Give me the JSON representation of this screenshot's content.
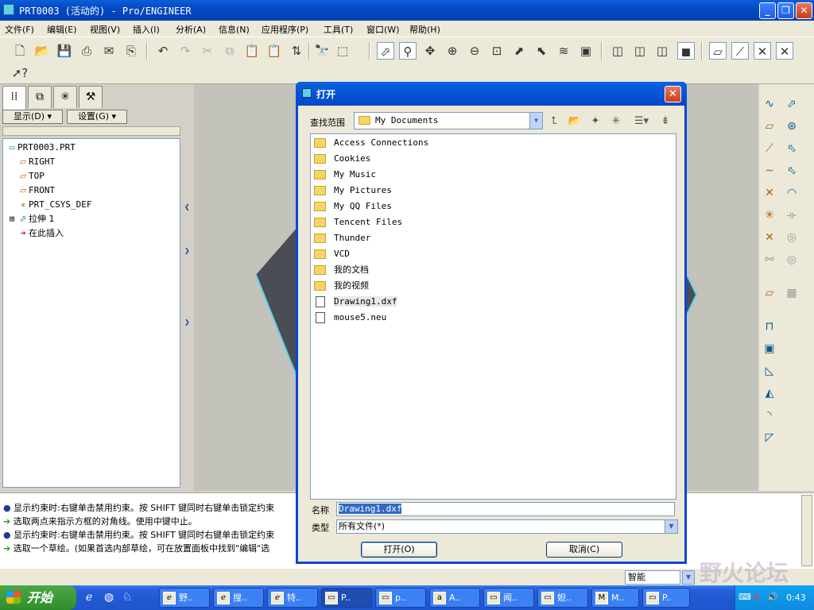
{
  "window": {
    "title": "PRT0003 (活动的) - Pro/ENGINEER"
  },
  "menu": [
    "文件(F)",
    "编辑(E)",
    "视图(V)",
    "插入(I)",
    "分析(A)",
    "信息(N)",
    "应用程序(P)",
    "工具(T)",
    "窗口(W)",
    "帮助(H)"
  ],
  "panel": {
    "show_button": "显示(D) ▾",
    "settings_button": "设置(G) ▾",
    "tree": [
      {
        "label": "PRT0003.PRT",
        "icon": "part-icon"
      },
      {
        "label": "RIGHT",
        "icon": "datum-plane-icon"
      },
      {
        "label": "TOP",
        "icon": "datum-plane-icon"
      },
      {
        "label": "FRONT",
        "icon": "datum-plane-icon"
      },
      {
        "label": "PRT_CSYS_DEF",
        "icon": "csys-icon"
      },
      {
        "label": "拉伸 1",
        "icon": "extrude-icon"
      },
      {
        "label": "在此插入",
        "icon": "insert-arrow-icon"
      }
    ]
  },
  "messages": [
    "显示约束时:右键单击禁用约束。按 SHIFT 键同时右键单击锁定约束",
    "选取两点来指示方框的对角线。使用中键中止。",
    "显示约束时:右键单击禁用约束。按 SHIFT 键同时右键单击锁定约束",
    "选取一个草绘。(如果首选内部草绘，可在放置面板中找到\"编辑\"选"
  ],
  "status": {
    "filter": "智能"
  },
  "dialog": {
    "title": "打开",
    "look_in_label": "查找范围",
    "look_in_value": "My Documents",
    "files": [
      {
        "name": "Access Connections",
        "type": "folder"
      },
      {
        "name": "Cookies",
        "type": "folder"
      },
      {
        "name": "My Music",
        "type": "folder"
      },
      {
        "name": "My Pictures",
        "type": "folder"
      },
      {
        "name": "My QQ Files",
        "type": "folder"
      },
      {
        "name": "Tencent Files",
        "type": "folder"
      },
      {
        "name": "Thunder",
        "type": "folder"
      },
      {
        "name": "VCD",
        "type": "folder"
      },
      {
        "name": "我的文档",
        "type": "folder"
      },
      {
        "name": "我的视频",
        "type": "folder"
      },
      {
        "name": "Drawing1.dxf",
        "type": "file"
      },
      {
        "name": "mouse5.neu",
        "type": "file"
      }
    ],
    "name_label": "名称",
    "name_value": "Drawing1.dxf",
    "type_label": "类型",
    "type_value": "所有文件(*)",
    "open_button": "打开(O)",
    "cancel_button": "取消(C)"
  },
  "taskbar": {
    "start": "开始",
    "tasks": [
      "野..",
      "搜..",
      "特..",
      "P..",
      "p..",
      "A..",
      "闻..",
      "妲..",
      "M..",
      "P.."
    ],
    "clock": "0:43",
    "watermark": "野火论坛"
  },
  "colors": {
    "titlebar": "#0549c4",
    "dialog_frame": "#0a46d8",
    "model_shade": "#4a4d55",
    "model_edge": "#5fd0e8"
  }
}
